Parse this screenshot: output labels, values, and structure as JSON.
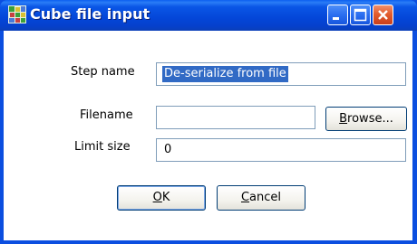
{
  "window": {
    "title": "Cube file input",
    "icon": "cube-app-icon",
    "controls": {
      "minimize_icon": "minimize-icon",
      "maximize_icon": "maximize-icon",
      "close_icon": "close-icon"
    }
  },
  "form": {
    "step_name": {
      "label": "Step name",
      "value": "De-serialize from file"
    },
    "filename": {
      "label": "Filename",
      "value": "",
      "browse": {
        "mnemonic": "B",
        "rest": "rowse..."
      }
    },
    "limit_size": {
      "label": "Limit size",
      "value": "0"
    }
  },
  "buttons": {
    "ok": {
      "mnemonic": "O",
      "rest": "K"
    },
    "cancel": {
      "mnemonic": "C",
      "rest": "ancel"
    }
  },
  "colors": {
    "titlebar": "#0446d8",
    "selection": "#316ac5",
    "field_border": "#7f9db9",
    "button_border": "#003c74"
  }
}
